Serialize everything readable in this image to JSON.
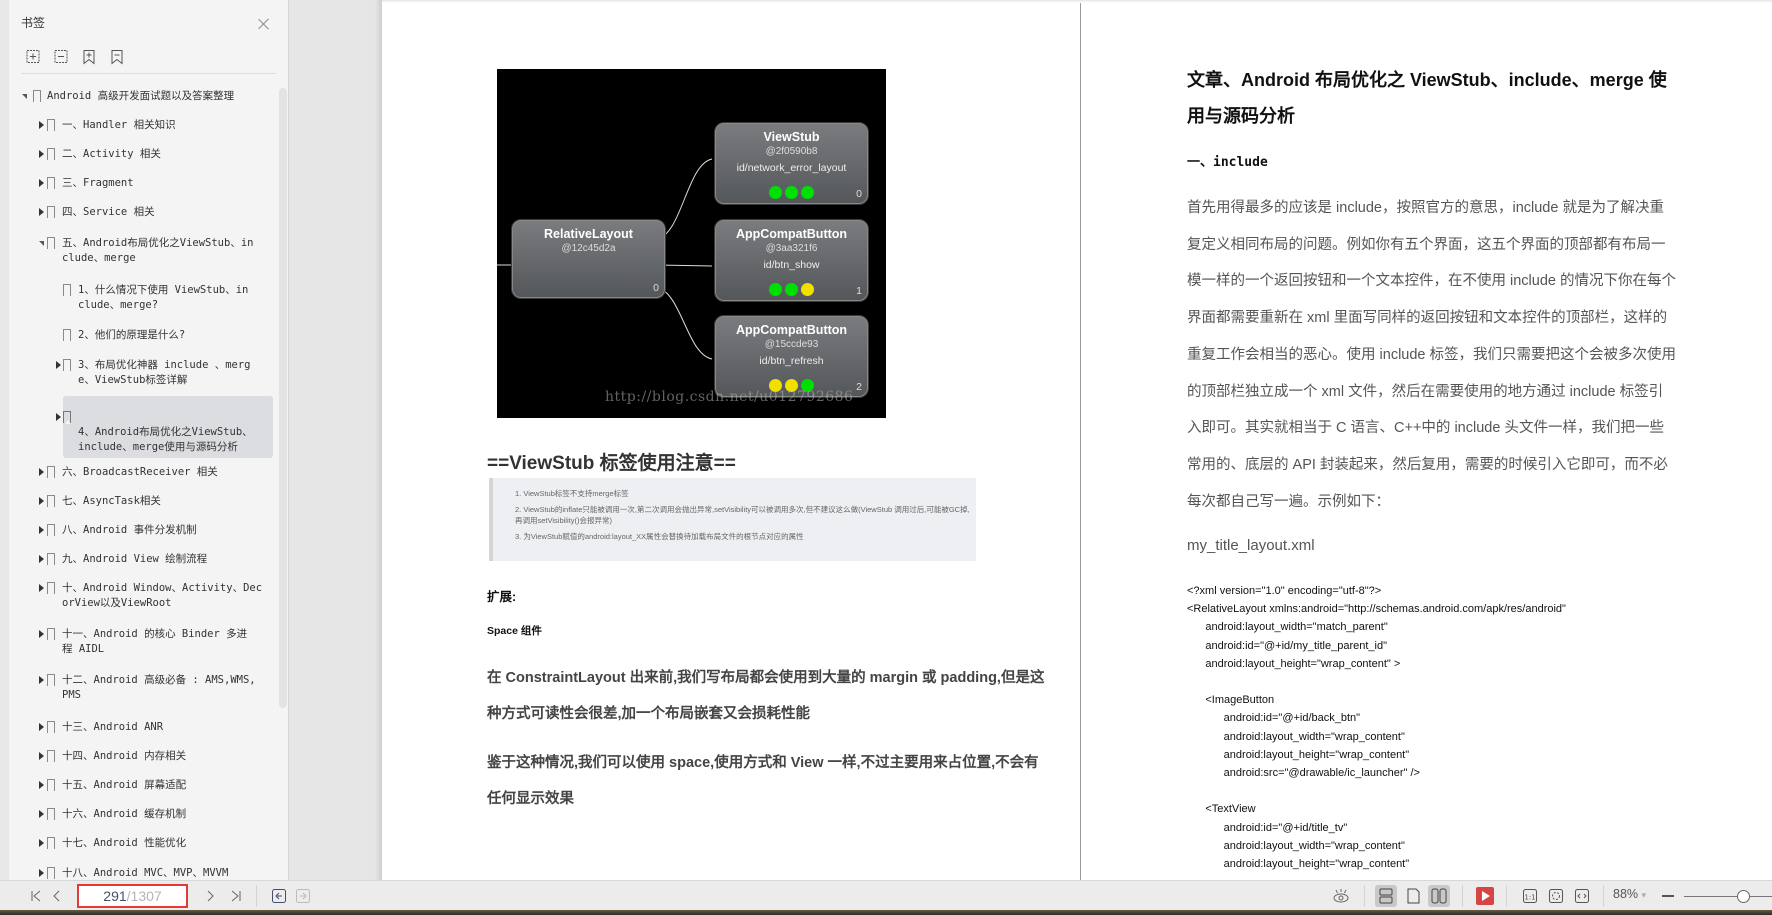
{
  "sidebar": {
    "title": "书签",
    "tools": [
      "expand-all-icon",
      "collapse-all-icon",
      "add-bookmark-icon",
      "remove-bookmark-icon"
    ],
    "items": [
      {
        "label": "Android 高级开发面试题以及答案整理",
        "level": 0,
        "expanded": true
      },
      {
        "label": "一、Handler 相关知识",
        "level": 1,
        "expanded": false
      },
      {
        "label": "二、Activity 相关",
        "level": 1,
        "expanded": false
      },
      {
        "label": "三、Fragment",
        "level": 1,
        "expanded": false
      },
      {
        "label": "四、Service 相关",
        "level": 1,
        "expanded": false
      },
      {
        "label": "五、Android布局优化之ViewStub、in\nclude、merge",
        "level": 1,
        "expanded": true
      },
      {
        "label": "1、什么情况下使用 ViewStub、in\nclude、merge?",
        "level": 2,
        "leaf": true
      },
      {
        "label": "2、他们的原理是什么?",
        "level": 2,
        "leaf": true
      },
      {
        "label": "3、布局优化神器 include 、merg\ne、ViewStub标签详解",
        "level": 2,
        "expanded": false
      },
      {
        "label": "4、Android布局优化之ViewStub、\ninclude、merge使用与源码分析",
        "level": 2,
        "expanded": false,
        "selected": true
      },
      {
        "label": "六、BroadcastReceiver 相关",
        "level": 1,
        "expanded": false
      },
      {
        "label": "七、AsyncTask相关",
        "level": 1,
        "expanded": false
      },
      {
        "label": "八、Android 事件分发机制",
        "level": 1,
        "expanded": false
      },
      {
        "label": "九、Android View 绘制流程",
        "level": 1,
        "expanded": false
      },
      {
        "label": "十、Android Window、Activity、Dec\norView以及ViewRoot",
        "level": 1,
        "expanded": false
      },
      {
        "label": "十一、Android 的核心 Binder 多进\n程 AIDL",
        "level": 1,
        "expanded": false
      },
      {
        "label": "十二、Android 高级必备 : AMS,WMS,\nPMS",
        "level": 1,
        "expanded": false
      },
      {
        "label": "十三、Android ANR",
        "level": 1,
        "expanded": false
      },
      {
        "label": "十四、Android 内存相关",
        "level": 1,
        "expanded": false
      },
      {
        "label": "十五、Android 屏幕适配",
        "level": 1,
        "expanded": false
      },
      {
        "label": "十六、Android 缓存机制",
        "level": 1,
        "expanded": false
      },
      {
        "label": "十七、Android 性能优化",
        "level": 1,
        "expanded": false
      },
      {
        "label": "十八、Android MVC、MVP、MVVM",
        "level": 1,
        "expanded": false
      }
    ]
  },
  "page1": {
    "diagram": {
      "nodes": [
        {
          "title": "RelativeLayout",
          "hash": "@12c45d2a",
          "id": "",
          "index": "0",
          "dots": []
        },
        {
          "title": "ViewStub",
          "hash": "@2f0590b8",
          "id": "id/network_error_layout",
          "index": "0",
          "dots": [
            "#00e000",
            "#00e000",
            "#00e000"
          ]
        },
        {
          "title": "AppCompatButton",
          "hash": "@3aa321f6",
          "id": "id/btn_show",
          "index": "1",
          "dots": [
            "#00e000",
            "#00e000",
            "#f0e000"
          ]
        },
        {
          "title": "AppCompatButton",
          "hash": "@15ccde93",
          "id": "id/btn_refresh",
          "index": "2",
          "dots": [
            "#f0e000",
            "#f0e000",
            "#00e000"
          ]
        }
      ],
      "watermark": "http://blog.csdn.net/u012792686"
    },
    "viewstub_heading": "==ViewStub 标签使用注意==",
    "notes": [
      "1. ViewStub标签不支持merge标签",
      "2. ViewStub的inflate只能被调用一次,第二次调用会抛出异常,setVisibility可以被调用多次,但不建议这么做(ViewStub 调用过后,可能被GC掉,再调用setVisibility()会报异常)",
      "3. 为ViewStub赋值的android:layout_XX属性会替换待加载布局文件的根节点对应的属性"
    ],
    "extension_label": "扩展:",
    "space_label": "Space 组件",
    "para1": "在 ConstraintLayout 出来前,我们写布局都会使用到大量的 margin 或 padding,但是这种方式可读性会很差,加一个布局嵌套又会损耗性能",
    "para2": "鉴于这种情况,我们可以使用 space,使用方式和 View 一样,不过主要用来占位置,不会有任何显示效果"
  },
  "page2": {
    "title": "文章、Android 布局优化之 ViewStub、include、merge 使用与源码分析",
    "section": "一、include",
    "body": "首先用得最多的应该是 include，按照官方的意思，include 就是为了解决重复定义相同布局的问题。例如你有五个界面，这五个界面的顶部都有布局一模一样的一个返回按钮和一个文本控件，在不使用 include 的情况下你在每个界面都需要重新在 xml 里面写同样的返回按钮和文本控件的顶部栏，这样的重复工作会相当的恶心。使用 include 标签，我们只需要把这个会被多次使用的顶部栏独立成一个 xml 文件，然后在需要使用的地方通过 include 标签引入即可。其实就相当于 C 语言、C++中的 include 头文件一样，我们把一些常用的、底层的 API 封装起来，然后复用，需要的时候引入它即可，而不必每次都自己写一遍。示例如下：",
    "filename": "my_title_layout.xml",
    "code": "<?xml version=\"1.0\" encoding=\"utf-8\"?>\n<RelativeLayout xmlns:android=\"http://schemas.android.com/apk/res/android\"\n      android:layout_width=\"match_parent\"\n      android:id=\"@+id/my_title_parent_id\"\n      android:layout_height=\"wrap_content\" >\n\n      <ImageButton\n            android:id=\"@+id/back_btn\"\n            android:layout_width=\"wrap_content\"\n            android:layout_height=\"wrap_content\"\n            android:src=\"@drawable/ic_launcher\" />\n\n      <TextView\n            android:id=\"@+id/title_tv\"\n            android:layout_width=\"wrap_content\"\n            android:layout_height=\"wrap_content\""
  },
  "bottombar": {
    "current_page": "291",
    "total_pages": "/1307",
    "zoom": "88%",
    "zoom_dropdown": "▾",
    "view_modes": {
      "continuous": true,
      "single": false,
      "two_page": true
    }
  }
}
